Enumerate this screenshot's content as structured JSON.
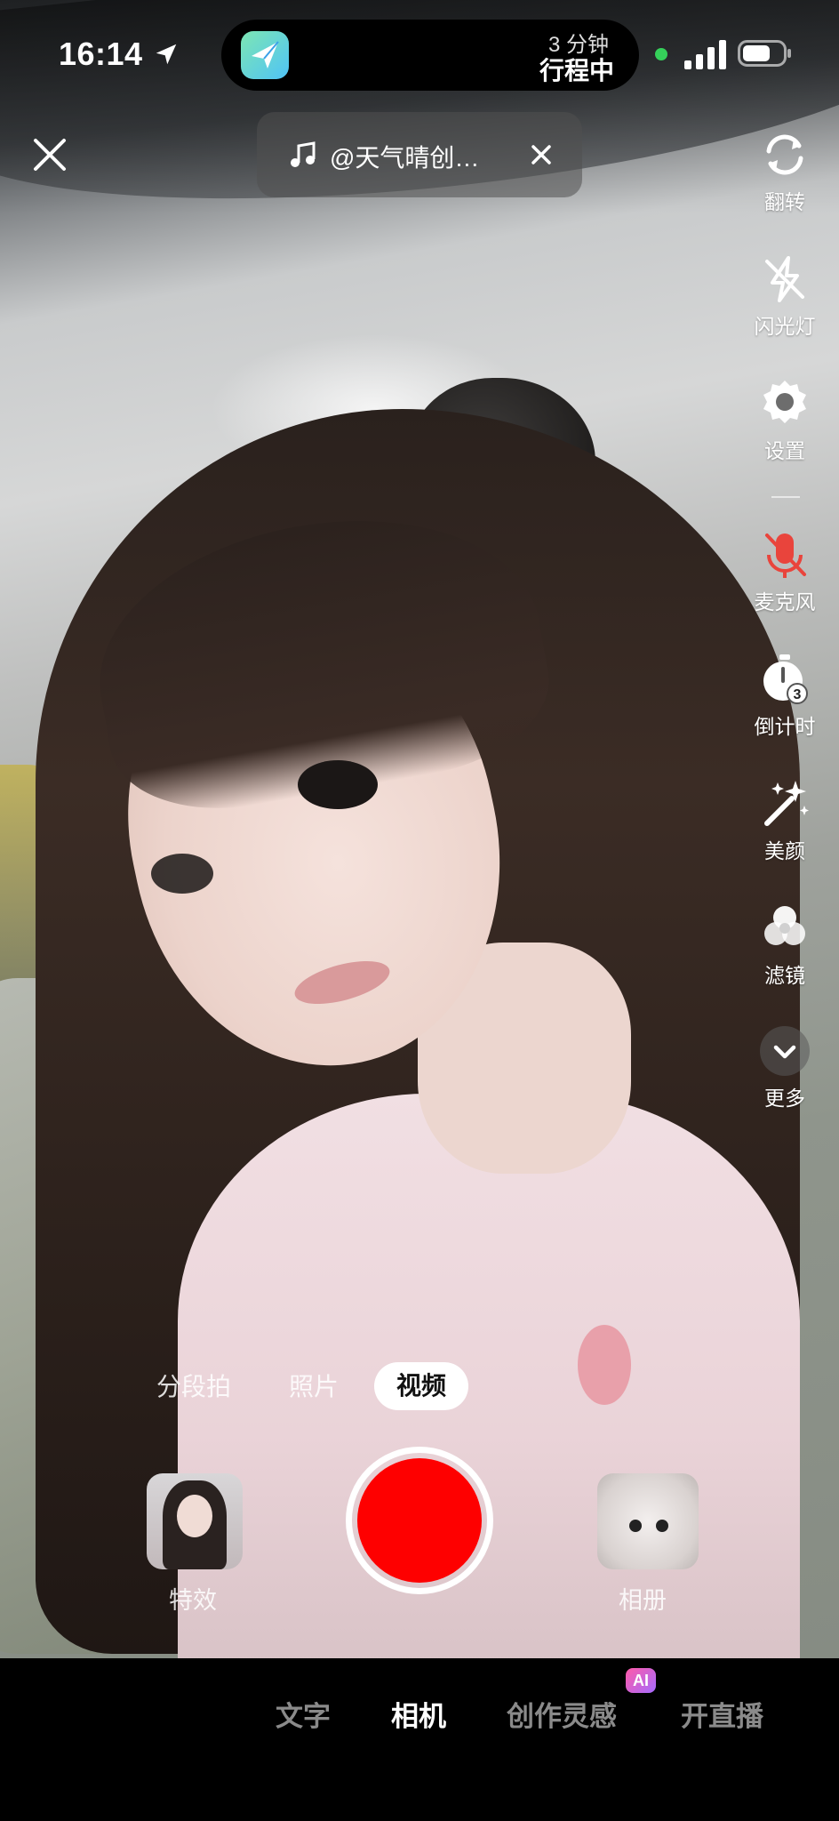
{
  "status_bar": {
    "time": "16:14",
    "island_sub": "3 分钟",
    "island_main": "行程中"
  },
  "music": {
    "label": "@天气晴创…"
  },
  "tools": [
    {
      "label": "翻转",
      "icon": "flip-camera-icon"
    },
    {
      "label": "闪光灯",
      "icon": "flash-off-icon"
    },
    {
      "label": "设置",
      "icon": "settings-gear-icon"
    },
    {
      "label": "麦克风",
      "icon": "microphone-muted-icon"
    },
    {
      "label": "倒计时",
      "icon": "countdown-timer-icon"
    },
    {
      "label": "美颜",
      "icon": "beauty-wand-icon"
    },
    {
      "label": "滤镜",
      "icon": "filter-circles-icon"
    },
    {
      "label": "更多",
      "icon": "chevron-down-icon"
    }
  ],
  "modes": {
    "segment": "分段拍",
    "photo": "照片",
    "video": "视频"
  },
  "capture": {
    "effects_label": "特效",
    "album_label": "相册"
  },
  "bottom_nav": {
    "text": "文字",
    "camera": "相机",
    "inspiration": "创作灵感",
    "ai_badge": "AI",
    "live": "开直播"
  },
  "colors": {
    "record": "#fe0000",
    "mic_muted": "#e9443c"
  }
}
